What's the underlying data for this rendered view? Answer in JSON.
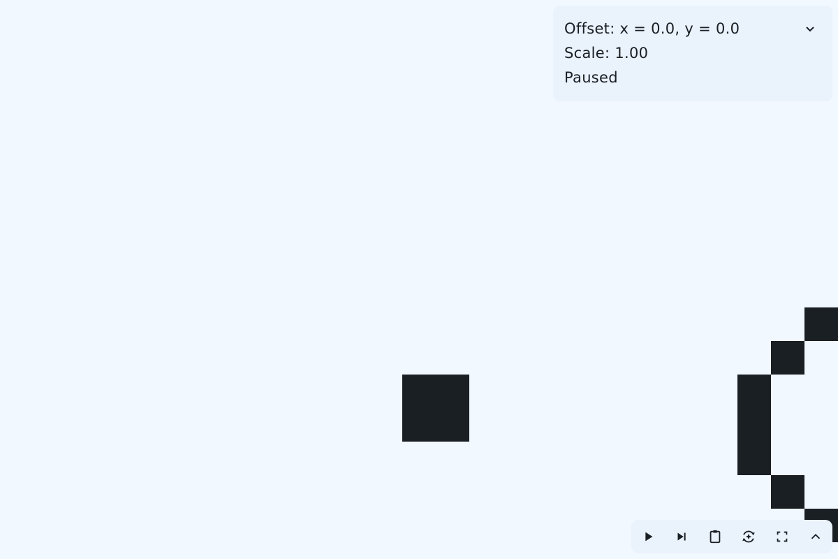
{
  "colors": {
    "background": "#f1f8ff",
    "cell_alive": "#1a1f24",
    "panel": "#eaf2fb",
    "text": "#1a1f24"
  },
  "info": {
    "offset_text": "Offset: x = 0.0, y = 0.0",
    "scale_text": "Scale: 1.00",
    "status_text": "Paused",
    "collapse_icon": "chevron-down-icon"
  },
  "board": {
    "state": "paused",
    "scale": 1.0,
    "offset": {
      "x": 0.0,
      "y": 0.0
    },
    "alive_cells": [
      {
        "col": 12,
        "row": 11
      },
      {
        "col": 13,
        "row": 11
      },
      {
        "col": 12,
        "row": 12
      },
      {
        "col": 13,
        "row": 12
      },
      {
        "col": 24,
        "row": 9
      },
      {
        "col": 23,
        "row": 10
      },
      {
        "col": 22,
        "row": 11
      },
      {
        "col": 22,
        "row": 12
      },
      {
        "col": 22,
        "row": 13
      },
      {
        "col": 23,
        "row": 14
      },
      {
        "col": 24,
        "row": 15
      }
    ]
  },
  "toolbar": {
    "buttons": [
      {
        "name": "play-button",
        "icon": "play-icon"
      },
      {
        "name": "step-button",
        "icon": "skip-next-icon"
      },
      {
        "name": "clipboard-button",
        "icon": "clipboard-icon"
      },
      {
        "name": "reset-button",
        "icon": "reset-icon"
      },
      {
        "name": "fullscreen-button",
        "icon": "fullscreen-icon"
      },
      {
        "name": "expand-button",
        "icon": "chevron-up-icon"
      }
    ]
  }
}
